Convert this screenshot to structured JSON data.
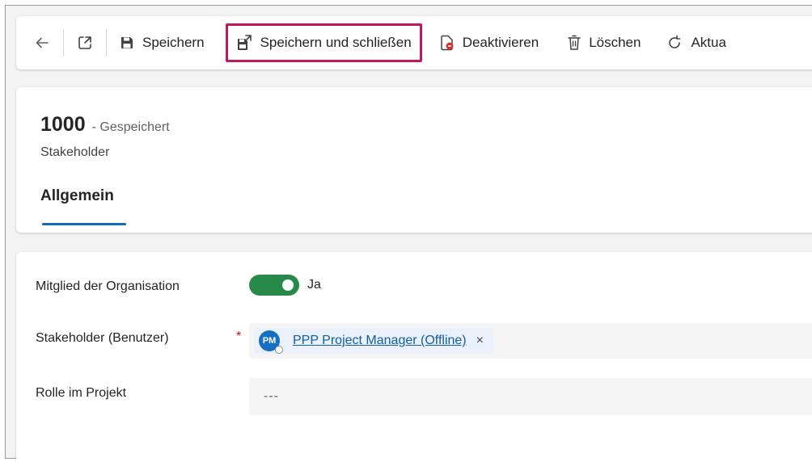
{
  "toolbar": {
    "back_label": "",
    "popout_label": "",
    "save_label": "Speichern",
    "save_close_label": "Speichern und schließen",
    "deactivate_label": "Deaktivieren",
    "delete_label": "Löschen",
    "refresh_label": "Aktua",
    "highlight_color": "#c2185b"
  },
  "record": {
    "id": "1000",
    "status": "- Gespeichert",
    "entity": "Stakeholder"
  },
  "tabs": [
    {
      "label": "Allgemein",
      "active": true
    }
  ],
  "form": {
    "member_label": "Mitglied der Organisation",
    "member_value": "Ja",
    "member_on": true,
    "stakeholder_label": "Stakeholder (Benutzer)",
    "required_mark": "*",
    "stakeholder_initials": "PM",
    "stakeholder_value": "PPP Project Manager (Offline)",
    "remove_glyph": "×",
    "role_label": "Rolle im Projekt",
    "role_value": "---"
  },
  "colors": {
    "accent": "#0f6cbd",
    "toggle_on": "#27894a",
    "link": "#115ea3",
    "required": "#c50f1f"
  }
}
